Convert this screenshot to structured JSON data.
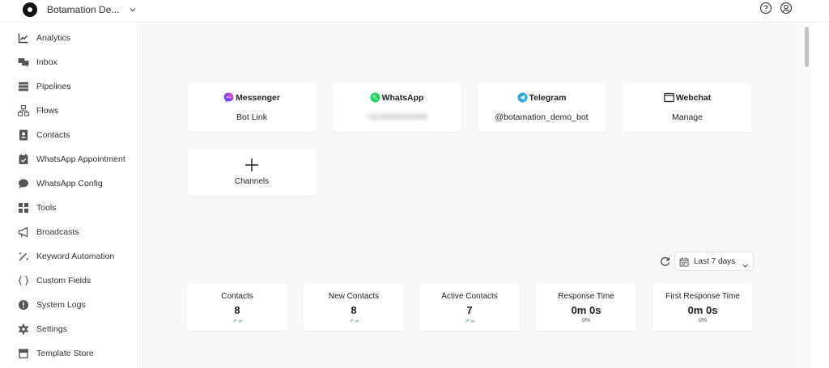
{
  "header": {
    "workspace_name": "Botamation De...",
    "help_icon": "help-circle-icon",
    "account_icon": "user-circle-icon"
  },
  "sidebar": {
    "items": [
      {
        "label": "Analytics",
        "icon": "chart-line-icon"
      },
      {
        "label": "Inbox",
        "icon": "chat-bubbles-icon"
      },
      {
        "label": "Pipelines",
        "icon": "pipeline-icon"
      },
      {
        "label": "Flows",
        "icon": "flow-tree-icon"
      },
      {
        "label": "Contacts",
        "icon": "contact-card-icon"
      },
      {
        "label": "WhatsApp Appointment",
        "icon": "calendar-check-icon"
      },
      {
        "label": "WhatsApp Config",
        "icon": "chat-icon"
      },
      {
        "label": "Tools",
        "icon": "grid-icon"
      },
      {
        "label": "Broadcasts",
        "icon": "megaphone-icon"
      },
      {
        "label": "Keyword Automation",
        "icon": "magic-wand-icon"
      },
      {
        "label": "Custom Fields",
        "icon": "braces-icon"
      },
      {
        "label": "System Logs",
        "icon": "alert-circle-icon"
      },
      {
        "label": "Settings",
        "icon": "gear-icon"
      },
      {
        "label": "Template Store",
        "icon": "store-icon"
      }
    ]
  },
  "channels": {
    "messenger": {
      "title": "Messenger",
      "link": "Bot Link"
    },
    "whatsapp": {
      "title": "WhatsApp",
      "value": "+919999999999"
    },
    "telegram": {
      "title": "Telegram",
      "handle": "@botamation_demo_bot"
    },
    "webchat": {
      "title": "Webchat",
      "link": "Manage"
    },
    "add": {
      "label": "Channels"
    }
  },
  "filters": {
    "date_range": "Last 7 days"
  },
  "stats": [
    {
      "label": "Contacts",
      "value": "8",
      "sub": "∞"
    },
    {
      "label": "New Contacts",
      "value": "8",
      "sub": "∞"
    },
    {
      "label": "Active Contacts",
      "value": "7",
      "sub": "∞"
    },
    {
      "label": "Response Time",
      "value": "0m 0s",
      "sub": "0%"
    },
    {
      "label": "First Response Time",
      "value": "0m 0s",
      "sub": "0%"
    }
  ],
  "colors": {
    "messenger": "#7b3fe4",
    "whatsapp": "#25d366",
    "telegram": "#2ca5e0",
    "trend_positive": "#3a9a5a"
  }
}
